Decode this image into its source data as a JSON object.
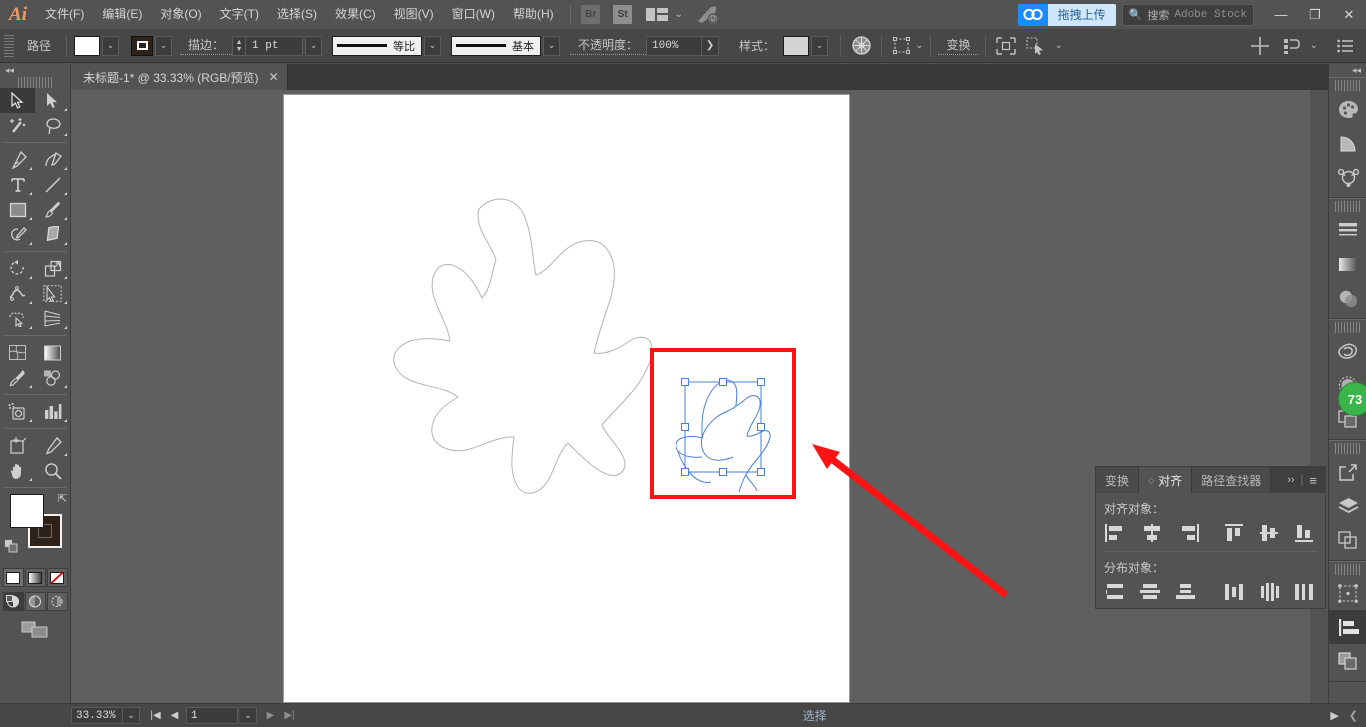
{
  "app": {
    "name": "Ai",
    "logo_text": "Ai"
  },
  "menubar": {
    "items": [
      {
        "label": "文件(F)",
        "accel": "F"
      },
      {
        "label": "编辑(E)",
        "accel": "E"
      },
      {
        "label": "对象(O)",
        "accel": "O"
      },
      {
        "label": "文字(T)",
        "accel": "T"
      },
      {
        "label": "选择(S)",
        "accel": "S"
      },
      {
        "label": "效果(C)",
        "accel": "C"
      },
      {
        "label": "视图(V)",
        "accel": "V"
      },
      {
        "label": "窗口(W)",
        "accel": "W"
      },
      {
        "label": "帮助(H)",
        "accel": "H"
      }
    ],
    "bridge_label": "Br",
    "stock_label": "St",
    "workspace_icon": "panel-layout-icon",
    "workspace_chevron": "⌄",
    "rocket_icon": "rocket-icon",
    "cc_icon": "creative-cloud-icon",
    "upload_label": "拖拽上传",
    "search_icon": "search-icon",
    "search_placeholder": "搜索 Adobe Stock",
    "search_label_cn": "搜索",
    "search_label_en": "Adobe Stock",
    "minimize": "—",
    "maximize": "❐",
    "close": "✕",
    "accent_blue": "#1a8cff",
    "upload_bg": "#cfe6fb"
  },
  "controlbar": {
    "context_label": "路径",
    "fill_swatch": "#ffffff",
    "stroke_swatch": "#2d2118",
    "stroke_label": "描边：",
    "stroke_weight": "1 pt",
    "variable_width_profile": "等比",
    "brush_definition": "基本",
    "opacity_label": "不透明度：",
    "opacity_value": "100%",
    "style_label": "样式：",
    "style_swatch": "#d4d4d4",
    "opacity_mask_icon": "opacity-mask-icon",
    "select_similar_icon": "select-similar-icon",
    "transform_label": "变换",
    "isolate_icon": "isolate-selected-icon",
    "recolor_icon": "recolor-artwork-icon",
    "align_center_icon": "align-center-icon",
    "distribute_icon": "distribute-icon",
    "options_icon": "panel-options-icon",
    "dropdown_glyph": "⌄",
    "arrow_glyph": "❯"
  },
  "tabbar": {
    "document_title": "未标题-1* @ 33.33% (RGB/预览)",
    "close_glyph": "✕"
  },
  "lefttoolbar": {
    "collapse_glyph": "◂◂",
    "tools": [
      {
        "name": "selection-tool",
        "label": "选择工具",
        "active": true
      },
      {
        "name": "direct-selection-tool",
        "label": "直接选择工具",
        "active": false
      },
      {
        "name": "magic-wand-tool",
        "label": "魔棒工具",
        "active": false
      },
      {
        "name": "lasso-tool",
        "label": "套索工具",
        "active": false
      },
      {
        "name": "pen-tool",
        "label": "钢笔工具",
        "active": false
      },
      {
        "name": "curvature-tool",
        "label": "曲率工具",
        "active": false
      },
      {
        "name": "type-tool",
        "label": "文字工具",
        "active": false
      },
      {
        "name": "line-segment-tool",
        "label": "直线段工具",
        "active": false
      },
      {
        "name": "rectangle-tool",
        "label": "矩形工具",
        "active": false
      },
      {
        "name": "paintbrush-tool",
        "label": "画笔工具",
        "active": false
      },
      {
        "name": "shaper-tool",
        "label": "Shaper 工具",
        "active": false
      },
      {
        "name": "eraser-tool",
        "label": "橡皮擦工具",
        "active": false
      },
      {
        "name": "rotate-tool",
        "label": "旋转工具",
        "active": false
      },
      {
        "name": "scale-tool",
        "label": "比例缩放工具",
        "active": false
      },
      {
        "name": "width-tool",
        "label": "宽度工具",
        "active": false
      },
      {
        "name": "free-transform-tool",
        "label": "自由变换工具",
        "active": false
      },
      {
        "name": "shape-builder-tool",
        "label": "形状生成器工具",
        "active": false
      },
      {
        "name": "perspective-grid-tool",
        "label": "透视网格工具",
        "active": false
      },
      {
        "name": "mesh-tool",
        "label": "网格工具",
        "active": false
      },
      {
        "name": "gradient-tool",
        "label": "渐变工具",
        "active": false
      },
      {
        "name": "eyedropper-tool",
        "label": "吸管工具",
        "active": false
      },
      {
        "name": "blend-tool",
        "label": "混合工具",
        "active": false
      },
      {
        "name": "symbol-sprayer-tool",
        "label": "符号喷枪工具",
        "active": false
      },
      {
        "name": "column-graph-tool",
        "label": "柱形图工具",
        "active": false
      },
      {
        "name": "artboard-tool",
        "label": "画板工具",
        "active": false
      },
      {
        "name": "slice-tool",
        "label": "切片工具",
        "active": false
      },
      {
        "name": "hand-tool",
        "label": "抓手工具",
        "active": false
      },
      {
        "name": "zoom-tool",
        "label": "缩放工具",
        "active": false
      }
    ],
    "fill_color": "#ffffff",
    "stroke_color": "#2d2118",
    "swap_icon": "swap-fill-stroke-icon",
    "default_icon": "default-fill-stroke-icon",
    "color_modes": [
      {
        "name": "color-mode-button",
        "selected": true
      },
      {
        "name": "gradient-mode-button",
        "selected": false
      },
      {
        "name": "none-mode-button",
        "selected": false
      }
    ],
    "draw_modes": [
      {
        "name": "draw-normal-button",
        "selected": true
      },
      {
        "name": "draw-behind-button",
        "selected": false
      },
      {
        "name": "draw-inside-button",
        "selected": false
      }
    ],
    "screen_mode": "change-screen-mode-button"
  },
  "rightdock": {
    "collapse_glyph": "◂◂",
    "groups": [
      {
        "items": [
          {
            "name": "color-panel-icon",
            "label": "颜色"
          },
          {
            "name": "color-guide-panel-icon",
            "label": "颜色参考"
          },
          {
            "name": "symbols-panel-icon",
            "label": "符号"
          }
        ]
      },
      {
        "items": [
          {
            "name": "stroke-panel-icon",
            "label": "描边"
          },
          {
            "name": "gradient-panel-icon",
            "label": "渐变"
          },
          {
            "name": "transparency-panel-icon",
            "label": "透明度"
          }
        ]
      },
      {
        "items": [
          {
            "name": "brushes-panel-icon",
            "label": "画笔"
          },
          {
            "name": "appearance-panel-icon",
            "label": "外观"
          },
          {
            "name": "graphic-styles-panel-icon",
            "label": "图形样式"
          }
        ]
      },
      {
        "items": [
          {
            "name": "links-panel-icon",
            "label": "链接"
          },
          {
            "name": "layers-panel-icon",
            "label": "图层"
          },
          {
            "name": "artboards-panel-icon",
            "label": "画板"
          }
        ]
      },
      {
        "items": [
          {
            "name": "transform-panel-icon",
            "label": "变换"
          },
          {
            "name": "align-panel-icon",
            "label": "对齐"
          },
          {
            "name": "pathfinder-panel-icon",
            "label": "路径查找器"
          }
        ]
      }
    ],
    "notification_badge": "73",
    "notification_color": "#39b54a"
  },
  "canvas": {
    "artboard_bg": "#ffffff",
    "shape_stroke": "#b4b4b4",
    "selection_color": "#4a7fd4",
    "annotation_color": "#fc1313",
    "annotation_rect_name": "red-highlight-rectangle",
    "annotation_arrow_name": "red-pointer-arrow",
    "selected_object_name": "selected-blob-path",
    "large_object_name": "large-blob-path"
  },
  "statusbar": {
    "zoom_level": "33.33%",
    "zoom_dropdown": "⌄",
    "first_page": "|◀",
    "prev_page": "◀",
    "page_number": "1",
    "page_dropdown": "⌄",
    "next_page": "▶",
    "last_page": "▶|",
    "status_text": "选择",
    "play_glyph": "▶",
    "collapse_glyph": "❮",
    "right_glyph": "❯"
  },
  "alignpanel": {
    "tabs": [
      {
        "label": "变换",
        "active": false,
        "name": "tab-transform"
      },
      {
        "label": "对齐",
        "active": true,
        "name": "tab-align"
      },
      {
        "label": "路径查找器",
        "active": false,
        "name": "tab-pathfinder"
      }
    ],
    "expand_glyph": "››",
    "menu_glyph": "≡",
    "align_objects_label": "对齐对象：",
    "distribute_objects_label": "分布对象：",
    "align_buttons": [
      {
        "name": "align-left-button",
        "label": "水平左对齐"
      },
      {
        "name": "align-horizontal-center-button",
        "label": "水平居中对齐"
      },
      {
        "name": "align-right-button",
        "label": "水平右对齐"
      },
      {
        "name": "align-top-button",
        "label": "垂直顶对齐"
      },
      {
        "name": "align-vertical-center-button",
        "label": "垂直居中对齐"
      },
      {
        "name": "align-bottom-button",
        "label": "垂直底对齐"
      }
    ],
    "distribute_buttons": [
      {
        "name": "distribute-vertical-top-button",
        "label": "垂直顶分布"
      },
      {
        "name": "distribute-vertical-center-button",
        "label": "垂直居中分布"
      },
      {
        "name": "distribute-vertical-bottom-button",
        "label": "垂直底分布"
      },
      {
        "name": "distribute-horizontal-left-button",
        "label": "水平左分布"
      },
      {
        "name": "distribute-horizontal-center-button",
        "label": "水平居中分布"
      },
      {
        "name": "distribute-horizontal-right-button",
        "label": "水平右分布"
      }
    ]
  }
}
